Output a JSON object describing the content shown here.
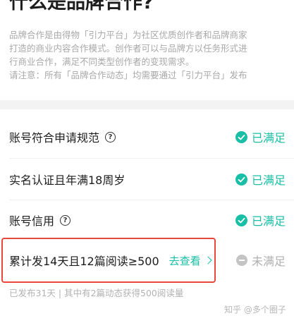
{
  "title": "什么是品牌合作?",
  "description": [
    "品牌合作是由得物「引力平台」为社区优质创作者和品牌商家",
    "打造的商业内容合作模式。创作者可以与品牌方以任务形式进",
    "行商业合作，满足不同类型创作者的变现需求。",
    "请注意：所有「品牌合作动态」均需要通过「引力平台」发布"
  ],
  "requirements": [
    {
      "label": "账号符合申请规范",
      "status": "已满足"
    },
    {
      "label": "实名认证且年满18周岁",
      "status": "已满足"
    },
    {
      "label": "账号信用",
      "status": "已满足"
    },
    {
      "label": "累计发14天且12篇阅读≥500",
      "link": "去查看",
      "status": "未满足"
    }
  ],
  "note": "已发布31天 | 其中有2篇动态获得500阅读量",
  "watermark": "知乎 @多个圈子",
  "colors": {
    "accent": "#18bfa6",
    "highlight": "#e8483c",
    "muted": "#b0b0b0"
  },
  "icons": {
    "help": "help-circle-icon",
    "met": "check-circle-icon",
    "unmet": "minus-circle-icon",
    "link": "chevron-right-icon"
  }
}
